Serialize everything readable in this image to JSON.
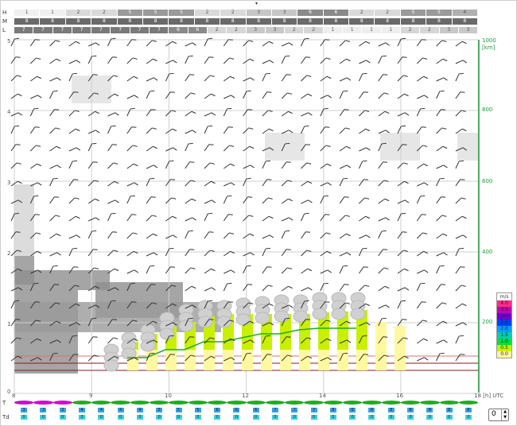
{
  "top_chevron": "▾",
  "rows": [
    {
      "label": "H",
      "cells": [
        "1",
        "1",
        "2",
        "2",
        "5",
        "5",
        "5",
        "2",
        "2",
        "3",
        "3",
        "6",
        "6",
        "2",
        "2",
        "5",
        "5",
        "4"
      ],
      "colors": [
        "#f0f0f0",
        "#f0f0f0",
        "#d9d9d9",
        "#d9d9d9",
        "#9a9a9a",
        "#9a9a9a",
        "#9a9a9a",
        "#d9d9d9",
        "#d9d9d9",
        "#c6c6c6",
        "#c6c6c6",
        "#8a8a8a",
        "#8a8a8a",
        "#d9d9d9",
        "#d9d9d9",
        "#9a9a9a",
        "#9a9a9a",
        "#b0b0b0"
      ]
    },
    {
      "label": "M",
      "cells": [
        "8",
        "8",
        "8",
        "8",
        "8",
        "8",
        "8",
        "8",
        "8",
        "8",
        "8",
        "8",
        "8",
        "8",
        "8",
        "8",
        "8",
        "8"
      ],
      "colors": [
        "#6a6a6a",
        "#6a6a6a",
        "#6a6a6a",
        "#6a6a6a",
        "#6a6a6a",
        "#6a6a6a",
        "#6a6a6a",
        "#6a6a6a",
        "#6a6a6a",
        "#6a6a6a",
        "#6a6a6a",
        "#6a6a6a",
        "#6a6a6a",
        "#6a6a6a",
        "#6a6a6a",
        "#6a6a6a",
        "#6a6a6a",
        "#6a6a6a"
      ]
    },
    {
      "label": "L",
      "cells": [
        "7",
        "7",
        "7",
        "7",
        "7",
        "7",
        "7",
        "7",
        "6",
        "6",
        "2",
        "2",
        "3",
        "3",
        "2",
        "2",
        "1",
        "1",
        "1",
        "1",
        "2",
        "2",
        "3",
        "3"
      ],
      "colors": [
        "#7a7a7a",
        "#7a7a7a",
        "#7a7a7a",
        "#7a7a7a",
        "#7a7a7a",
        "#7a7a7a",
        "#7a7a7a",
        "#7a7a7a",
        "#8a8a8a",
        "#8a8a8a",
        "#d6d6d6",
        "#d6d6d6",
        "#c8c8c8",
        "#c8c8c8",
        "#d6d6d6",
        "#d6d6d6",
        "#eeeeee",
        "#eeeeee",
        "#eeeeee",
        "#eeeeee",
        "#d6d6d6",
        "#d6d6d6",
        "#c8c8c8",
        "#c8c8c8"
      ]
    }
  ],
  "y_ticks": [
    "5",
    "4",
    "3",
    "2",
    "1",
    "0"
  ],
  "km_ticks": [
    "1000",
    "800",
    "600",
    "400",
    "200"
  ],
  "km_unit": "[km]",
  "x_ticks": [
    "8",
    "10",
    "12",
    "14",
    "16",
    "18"
  ],
  "x_unit": "[h] UTC",
  "legend": {
    "unit": "m/s",
    "entries": [
      {
        "label": "4.0",
        "color": "#ff2a8a"
      },
      {
        "label": "3.5",
        "color": "#c000c0"
      },
      {
        "label": "3.0",
        "color": "#7000d0"
      },
      {
        "label": "2.5",
        "color": "#0040ff"
      },
      {
        "label": "2.0",
        "color": "#00a0ff"
      },
      {
        "label": "1.5",
        "color": "#00d0b0"
      },
      {
        "label": "1.0",
        "color": "#00e040"
      },
      {
        "label": "0.5",
        "color": "#c8f000"
      },
      {
        "label": "0.0",
        "color": "#fff8a0"
      }
    ]
  },
  "bottom": {
    "t_label": "T",
    "td_label": "Td",
    "t_values": [
      "3",
      "3",
      "3",
      "4",
      "4",
      "4",
      "4",
      "5",
      "5",
      "5",
      "6",
      "6",
      "6",
      "7",
      "7",
      "7",
      "8",
      "8",
      "8",
      "8",
      "8",
      "8",
      "8",
      "8"
    ],
    "td_values": [
      "0",
      "0",
      "0",
      "0",
      "0",
      "0",
      "0",
      "0",
      "0",
      "0",
      "0",
      "0",
      "0",
      "0",
      "0",
      "0",
      "0",
      "0",
      "0",
      "0",
      "0",
      "0",
      "0",
      "0"
    ],
    "stepper_value": "0"
  },
  "colors": {
    "grid": "#cfcfcf",
    "km_axis": "#1a9e3a",
    "thermal": "#22aa22",
    "inversion": "#8b1a1a",
    "barb": "#333333"
  }
}
